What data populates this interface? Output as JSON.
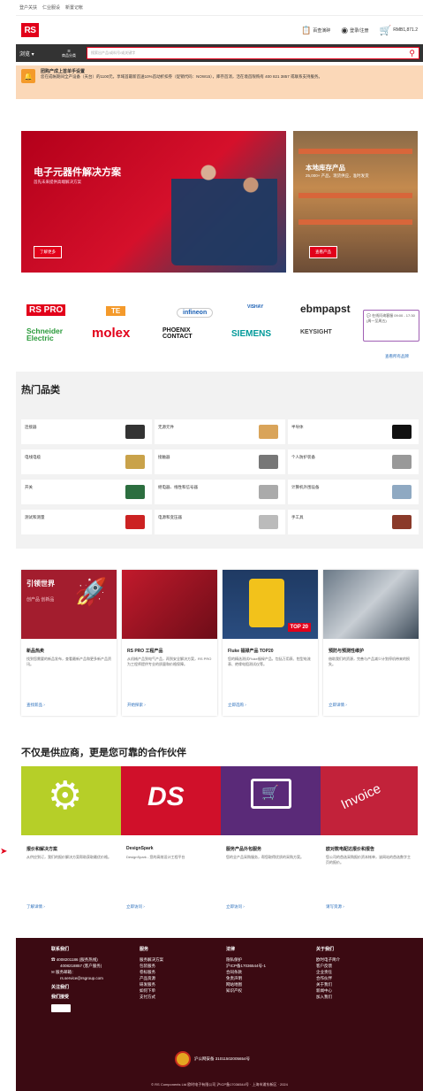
{
  "topnav": {
    "items": [
      "登户关扶",
      "仁业服设",
      "新置记帐"
    ]
  },
  "header": {
    "logo": "RS",
    "quote": "百查演碎",
    "login": "登录/注册",
    "cart_amount": "RMB1,871.2"
  },
  "searchbar": {
    "lang": "浏览",
    "category": "商品分类",
    "placeholder": "搜索出产品/或料号/或关键字"
  },
  "notice": {
    "title": "团购产成上首单手设置",
    "text": "您在成帐期间全产设备（天台）的1100元，享域首最新首送10%首动折扣券（促销代码：NOW15），库存首消，活在境首限购有 400 821 3857 或联系支持服务。"
  },
  "banner_main": {
    "title": "电子元器件解决方案",
    "subtitle": "首先未来提供高端解决方案",
    "button": "了解更多"
  },
  "banner_side": {
    "title": "本地库存产品",
    "subtitle": "25,000+ 产品，现货供应，准时发货",
    "button": "查看产品"
  },
  "brands": {
    "items": [
      "RS PRO",
      "TE",
      "infineon",
      "VISHAY",
      "ebmpapst",
      "Schneider Electric",
      "molex",
      "PHOENIX CONTACT",
      "SIEMENS",
      "KEYSIGHT"
    ],
    "tooltip": "在线问询客服 09:00 - 17:30 (周一至周五)",
    "more": "查看所有品牌"
  },
  "hot": {
    "title": "热门品类",
    "categories": [
      "连接器",
      "无源元件",
      "半导体",
      "电线电缆",
      "接触器",
      "个人防护装备",
      "开关",
      "继电器、线性和信号器",
      "计算机外围设备",
      "测试和测量",
      "电源和变压器",
      "手工具"
    ]
  },
  "features": [
    {
      "tag": "引领世界",
      "tag_sub": "创产品 创新品",
      "title": "新品热卖",
      "desc": "找到您需要的新品发布，查看最新产品和更多新产品资讯。",
      "link": "查找新品 ›"
    },
    {
      "title": "RS PRO 工程产品",
      "desc": "从机械产品到电气产品，再到安全解决方案，RS PRO 为工程师提供专业的质量和价格保障。",
      "link": "开始探索 ›"
    },
    {
      "title": "Fluke 福禄产品 TOP20",
      "desc": "您的精选测试Fluke福禄产品，包括万用表、钳型电流表、绝缘电阻测试仪等。",
      "badge": "TOP 20",
      "link": "立即选购 ›"
    },
    {
      "title": "预防与预测性维护",
      "desc": "借助我们的资源，完善与产品减少计划停机带来的损失。",
      "link": "立即详情 ›"
    }
  ],
  "partner": {
    "title": "不仅是供应商，更是您可靠的合作伙伴",
    "cards": [
      {
        "title": "报价和解决方案",
        "desc": "从供应到订，我们的报价解决方案帮助获取最优价格。",
        "link": "了解详情 ›"
      },
      {
        "title": "DesignSpark",
        "desc": "DesignSpark - 您的高效设计工程平台",
        "logo": "DS",
        "link": "立即访问 ›"
      },
      {
        "title": "服务产品外包服务",
        "desc": "您的全产品采购服务，帮您取得优质的采购方案。",
        "link": "立即访问 ›"
      },
      {
        "title": "欧对数电配达报价和报告",
        "desc": "您公司的首选采购报价资本帐单，该网站的首选数字主页的报价。",
        "invoice": "Invoice",
        "link": "请写资源 ›"
      }
    ]
  },
  "footer": {
    "contact": {
      "title": "联系我们",
      "phone1": "4008201186 (服务热线)",
      "phone2": "4008218857 (客户服务)",
      "email_label": "服务邮箱：",
      "email": "rs.service@rsgroup.com",
      "follow": "关注我们",
      "pay": "我们接受"
    },
    "service": {
      "title": "服务",
      "links": [
        "服务解决方案",
        "包装服务",
        "卷标服务",
        "产品资源",
        "研发服务",
        "如何下单",
        "支付方式"
      ]
    },
    "legal": {
      "title": "法律",
      "links": [
        "隐私保护",
        "沪ICP备17036544号-1",
        "合同条款",
        "免责声明",
        "网站地图",
        "知识产权"
      ]
    },
    "about": {
      "title": "关于我们",
      "links": [
        "欧时电子简介",
        "客户反馈",
        "企业责任",
        "合作伙伴",
        "关于我们",
        "新闻中心",
        "加入我们"
      ]
    },
    "icp": "沪公网安备 31011502005654号",
    "copyright": "© RS Components Ltd 欧时电子有限公司 沪ICP备17036544号 · 上海市浦东新区 · 2024"
  },
  "colors": {
    "brand_red": "#e2001a",
    "footer": "#3b0a12",
    "link": "#2a6ebb"
  }
}
